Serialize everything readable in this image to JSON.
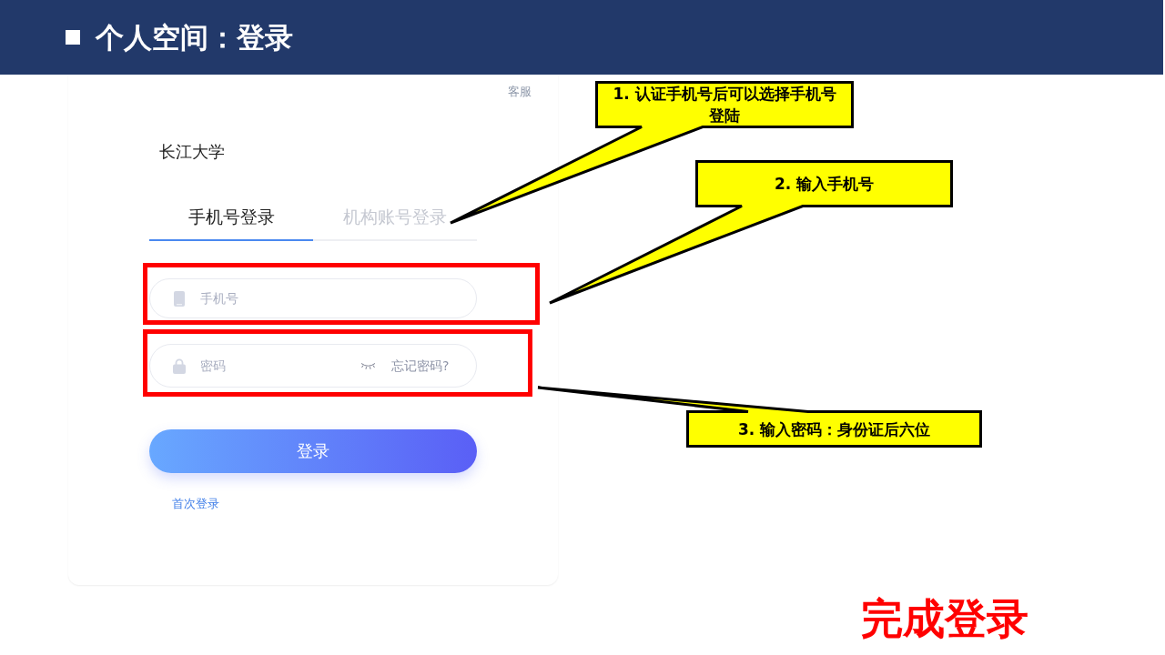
{
  "slide": {
    "title": "个人空间：登录"
  },
  "login": {
    "service_link": "客服",
    "school_name": "长江大学",
    "tabs": [
      {
        "label": "手机号登录",
        "selected": true
      },
      {
        "label": "机构账号登录",
        "selected": false
      }
    ],
    "phone_field": {
      "placeholder": "手机号"
    },
    "password_field": {
      "placeholder": "密码",
      "forgot_link": "忘记密码?"
    },
    "login_button": "登录",
    "first_login_link": "首次登录"
  },
  "annotations": {
    "callouts": [
      {
        "text": "1. 认证手机号后可以选择手机号登陆"
      },
      {
        "text": "2. 输入手机号"
      },
      {
        "text": "3. 输入密码：身份证后六位"
      }
    ],
    "completion_caption": "完成登录"
  }
}
